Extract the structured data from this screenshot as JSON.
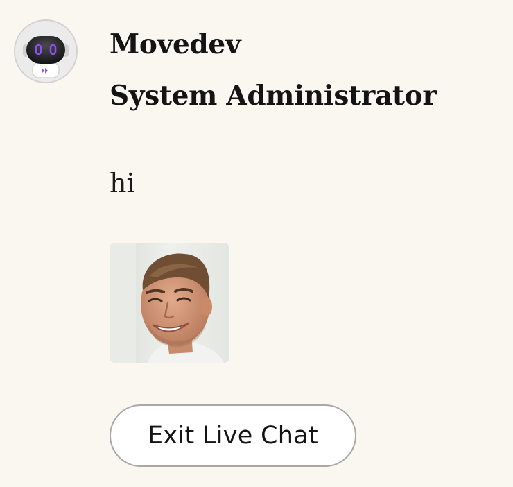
{
  "message_header": {
    "sender_name": "Movedev",
    "sender_role": "System Administrator",
    "avatar_icon": "robot-icon"
  },
  "message": {
    "text": "hi",
    "attachment_image": "person-photo"
  },
  "actions": {
    "exit_label": "Exit Live Chat"
  },
  "colors": {
    "background": "#faf7f0",
    "text": "#141414",
    "robot_accent": "#8a52f0",
    "button_border": "#a8a8a8"
  }
}
